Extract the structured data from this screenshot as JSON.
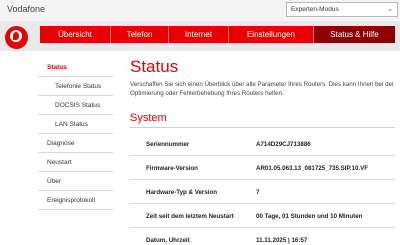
{
  "header": {
    "brand": "Vodafone",
    "mode_select": {
      "selected": "Experten-Modus"
    }
  },
  "nav": {
    "items": [
      {
        "label": "Übersicht",
        "active": false
      },
      {
        "label": "Telefon",
        "active": false
      },
      {
        "label": "Internet",
        "active": false
      },
      {
        "label": "Einstellungen",
        "active": false
      },
      {
        "label": "Status & Hilfe",
        "active": true
      }
    ]
  },
  "sidebar": {
    "items": [
      {
        "label": "Status",
        "active": true,
        "sub": false
      },
      {
        "label": "Telefonie Status",
        "active": false,
        "sub": true
      },
      {
        "label": "DOCSIS Status",
        "active": false,
        "sub": true
      },
      {
        "label": "LAN Status",
        "active": false,
        "sub": true
      },
      {
        "label": "Diagnose",
        "active": false,
        "sub": false
      },
      {
        "label": "Neustart",
        "active": false,
        "sub": false
      },
      {
        "label": "Über",
        "active": false,
        "sub": false
      },
      {
        "label": "Ereignisprotokoll",
        "active": false,
        "sub": false
      }
    ]
  },
  "main": {
    "title": "Status",
    "intro": "Verschaffen Sie sich einen Überblick über alle Parameter Ihres Routers. Dies kann Ihnen bei der Optimierung oder Fehlerbehebung Ihres Routers helfen.",
    "section_title": "System",
    "rows": [
      {
        "key": "Seriennummer",
        "value": "A714D29CJ713886"
      },
      {
        "key": "Firmware-Version",
        "value": "AR01.05.063.13_081725_735.SIP.10.VF"
      },
      {
        "key": "Hardware-Typ & Version",
        "value": "7"
      },
      {
        "key": "Zeit seit dem letztem Neustart",
        "value": "00 Tage, 01 Stunden und 10 Minuten"
      },
      {
        "key": "Datum, Uhrzeit",
        "value": "11.11.2025 | 16:57"
      }
    ]
  },
  "colors": {
    "brand_red": "#e60000",
    "active_nav": "#8e0000"
  }
}
